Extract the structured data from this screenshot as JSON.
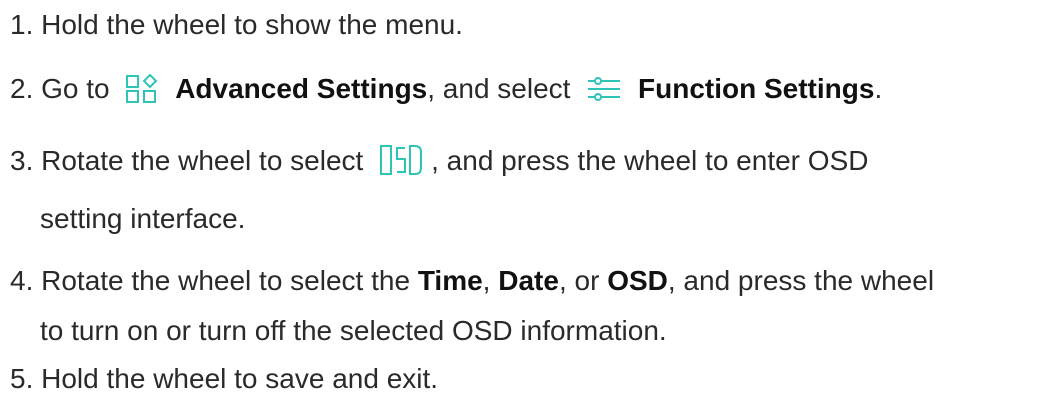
{
  "colors": {
    "text": "#2a2a2a",
    "bold_text": "#111111",
    "icon_accent": "#2ec4b6"
  },
  "steps": {
    "s1": {
      "text": "1. Hold the wheel to show the menu."
    },
    "s2": {
      "prefix": "2. Go to",
      "icon1": "advanced-settings-icon",
      "menu1": "Advanced Settings",
      "mid": ", and select",
      "icon2": "function-settings-sliders-icon",
      "menu2": "Function Settings",
      "suffix": "."
    },
    "s3": {
      "prefix": "3. Rotate the wheel to select",
      "icon": "osd-icon",
      "suffix": ", and press the wheel to enter OSD",
      "line2": "setting interface."
    },
    "s4": {
      "prefix": "4. Rotate the wheel to select the",
      "time": "Time",
      "sep1": ",",
      "date": "Date",
      "sep2": ", or",
      "osd": "OSD",
      "suffix": ", and press the wheel",
      "line2": "to turn on or turn off the selected OSD information."
    },
    "s5": {
      "text": "5. Hold the wheel to save and exit."
    }
  }
}
